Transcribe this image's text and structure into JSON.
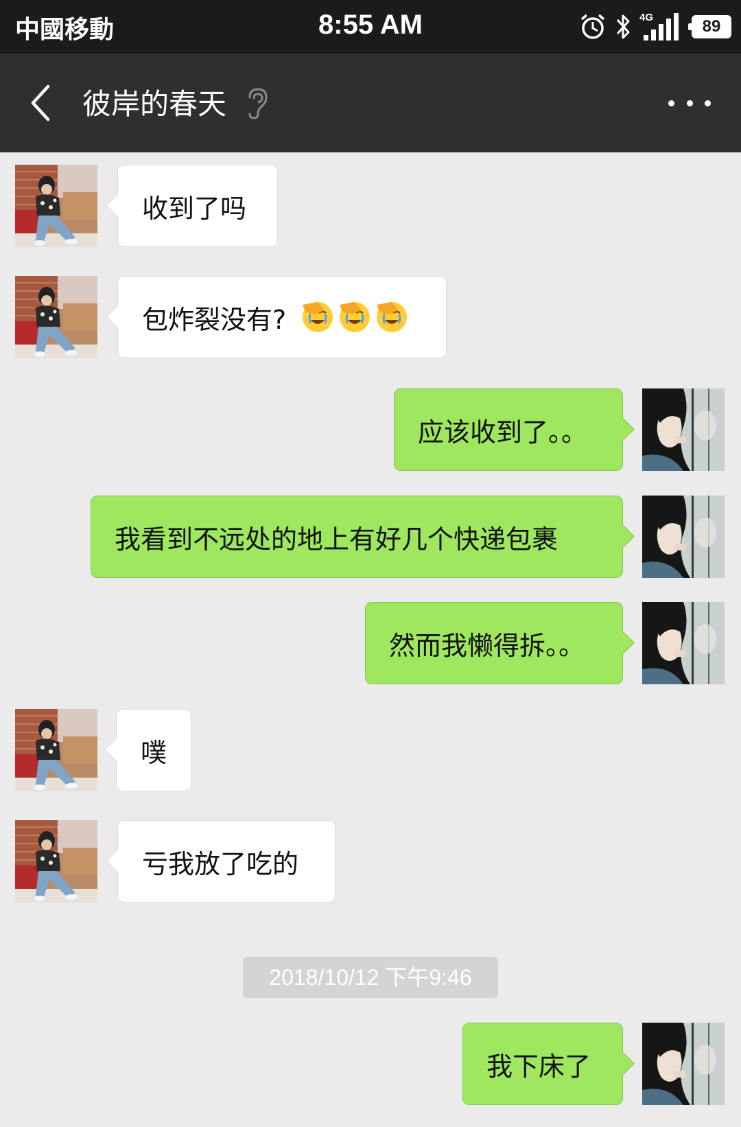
{
  "status_bar": {
    "carrier": "中國移動",
    "time": "8:55 AM",
    "network_type": "4G",
    "battery": "89",
    "icons": [
      "alarm-icon",
      "bluetooth-icon",
      "signal-icon",
      "battery-icon"
    ]
  },
  "nav": {
    "title": "彼岸的春天",
    "back_icon": "chevron-left-icon",
    "earpiece_icon": "ear-icon",
    "more_icon": "more-dots-icon"
  },
  "messages": [
    {
      "direction": "incoming",
      "text": "收到了吗"
    },
    {
      "direction": "incoming",
      "text": "包炸裂没有?",
      "emojis": [
        "face-palm-emoji",
        "face-palm-emoji",
        "face-palm-emoji"
      ]
    },
    {
      "direction": "outgoing",
      "text": "应该收到了。。"
    },
    {
      "direction": "outgoing",
      "text": "我看到不远处的地上有好几个快递包裹"
    },
    {
      "direction": "outgoing",
      "text": "然而我懒得拆。。"
    },
    {
      "direction": "incoming",
      "text": "噗"
    },
    {
      "direction": "incoming",
      "text": "亏我放了吃的"
    },
    {
      "direction": "outgoing",
      "text": "我下床了"
    }
  ],
  "timestamp": "2018/10/12 下午9:46",
  "colors": {
    "status_bar": "#1b1b1b",
    "nav_bar": "#2f2f2f",
    "chat_background": "#ebebeb",
    "incoming_bubble": "#ffffff",
    "outgoing_bubble": "#9ee75f",
    "timestamp_pill": "#d4d4d4"
  }
}
